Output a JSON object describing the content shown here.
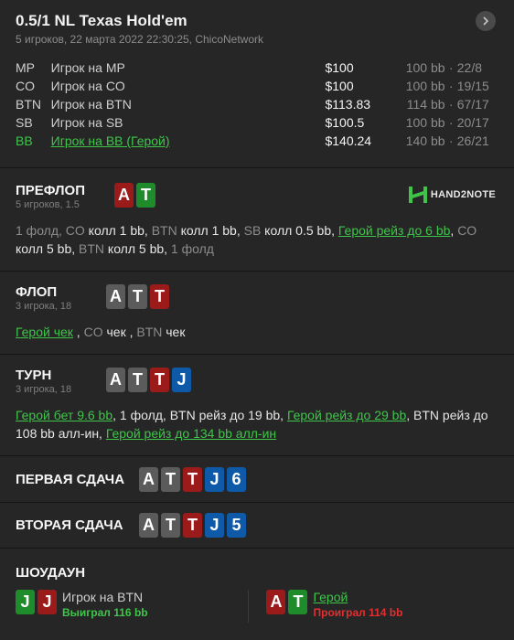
{
  "header": {
    "title": "0.5/1 NL Texas Hold'em",
    "subtitle": "5 игроков, 22 марта 2022 22:30:25, ChicoNetwork",
    "next_icon": "chevron-right-icon"
  },
  "players": [
    {
      "pos": "MP",
      "name": "Игрок на MP",
      "stack": "$100",
      "bb": "100 bb",
      "sep": "·",
      "ratio": "22/8",
      "hero": false
    },
    {
      "pos": "CO",
      "name": "Игрок на CO",
      "stack": "$100",
      "bb": "100 bb",
      "sep": "·",
      "ratio": "19/15",
      "hero": false
    },
    {
      "pos": "BTN",
      "name": "Игрок на BTN",
      "stack": "$113.83",
      "bb": "114 bb",
      "sep": "·",
      "ratio": "67/17",
      "hero": false
    },
    {
      "pos": "SB",
      "name": "Игрок на SB",
      "stack": "$100.5",
      "bb": "100 bb",
      "sep": "·",
      "ratio": "20/17",
      "hero": false
    },
    {
      "pos": "BB",
      "name": "Игрок на BB (Герой)",
      "stack": "$140.24",
      "bb": "140 bb",
      "sep": "·",
      "ratio": "26/21",
      "hero": true
    }
  ],
  "preflop": {
    "title": "ПРЕФЛОП",
    "sub": "5 игроков, 1.5",
    "cards": [
      {
        "rank": "A",
        "color": "red"
      },
      {
        "rank": "T",
        "color": "green"
      }
    ],
    "logo": "HAND2NOTE",
    "actions": [
      {
        "t": "1 фолд, ",
        "c": "muted"
      },
      {
        "t": "CO",
        "c": "muted"
      },
      {
        "t": " колл 1 bb, ",
        "c": ""
      },
      {
        "t": "BTN",
        "c": "muted"
      },
      {
        "t": " колл 1 bb, ",
        "c": ""
      },
      {
        "t": "SB",
        "c": "muted"
      },
      {
        "t": " колл 0.5 bb, ",
        "c": ""
      },
      {
        "t": "Герой рейз до 6 bb",
        "c": "hero"
      },
      {
        "t": ", ",
        "c": ""
      },
      {
        "t": "CO",
        "c": "muted"
      },
      {
        "t": " колл 5 bb, ",
        "c": ""
      },
      {
        "t": "BTN",
        "c": "muted"
      },
      {
        "t": " колл 5 bb, ",
        "c": ""
      },
      {
        "t": "1 фолд",
        "c": "muted"
      }
    ]
  },
  "flop": {
    "title": "ФЛОП",
    "sub": "3 игрока, 18",
    "cards": [
      {
        "rank": "A",
        "color": "gray"
      },
      {
        "rank": "T",
        "color": "gray"
      },
      {
        "rank": "T",
        "color": "red"
      }
    ],
    "actions": [
      {
        "t": "Герой чек",
        "c": "hero"
      },
      {
        "t": " , ",
        "c": ""
      },
      {
        "t": "CO",
        "c": "muted"
      },
      {
        "t": " чек , ",
        "c": ""
      },
      {
        "t": "BTN",
        "c": "muted"
      },
      {
        "t": " чек",
        "c": ""
      }
    ]
  },
  "turn": {
    "title": "ТУРН",
    "sub": "3 игрока, 18",
    "cards": [
      {
        "rank": "A",
        "color": "gray"
      },
      {
        "rank": "T",
        "color": "gray"
      },
      {
        "rank": "T",
        "color": "red"
      },
      {
        "rank": "J",
        "color": "blue"
      }
    ],
    "actions": [
      {
        "t": "Герой бет 9.6 bb",
        "c": "hero"
      },
      {
        "t": ", 1 фолд, ",
        "c": ""
      },
      {
        "t": "BTN",
        "c": ""
      },
      {
        "t": " рейз до 19 bb, ",
        "c": ""
      },
      {
        "t": "Герой рейз до 29 bb",
        "c": "hero"
      },
      {
        "t": ", ",
        "c": ""
      },
      {
        "t": "BTN",
        "c": ""
      },
      {
        "t": " рейз до 108 bb алл-ин, ",
        "c": ""
      },
      {
        "t": "Герой рейз до 134 bb алл-ин",
        "c": "hero"
      }
    ]
  },
  "run1": {
    "title": "ПЕРВАЯ СДАЧА",
    "cards": [
      {
        "rank": "A",
        "color": "gray"
      },
      {
        "rank": "T",
        "color": "gray"
      },
      {
        "rank": "T",
        "color": "red"
      },
      {
        "rank": "J",
        "color": "blue"
      },
      {
        "rank": "6",
        "color": "blue"
      }
    ]
  },
  "run2": {
    "title": "ВТОРАЯ СДАЧА",
    "cards": [
      {
        "rank": "A",
        "color": "gray"
      },
      {
        "rank": "T",
        "color": "gray"
      },
      {
        "rank": "T",
        "color": "red"
      },
      {
        "rank": "J",
        "color": "blue"
      },
      {
        "rank": "5",
        "color": "blue"
      }
    ]
  },
  "showdown": {
    "title": "ШОУДАУН",
    "players": [
      {
        "name": "Игрок на BTN",
        "result": "Выиграл 116 bb",
        "win": true,
        "hero": false,
        "cards": [
          {
            "rank": "J",
            "color": "green"
          },
          {
            "rank": "J",
            "color": "red"
          }
        ]
      },
      {
        "name": "Герой",
        "result": "Проиграл 114 bb",
        "win": false,
        "hero": true,
        "cards": [
          {
            "rank": "A",
            "color": "red"
          },
          {
            "rank": "T",
            "color": "green"
          }
        ]
      }
    ]
  },
  "colors": {
    "bg": "#1f1f1f",
    "panel": "#262626",
    "hero": "#3ec54a",
    "lose": "#e03030",
    "card_red": "#9b1b1b",
    "card_green": "#1f8c2c",
    "card_gray": "#5b5b5b",
    "card_blue": "#0f5aa8"
  }
}
